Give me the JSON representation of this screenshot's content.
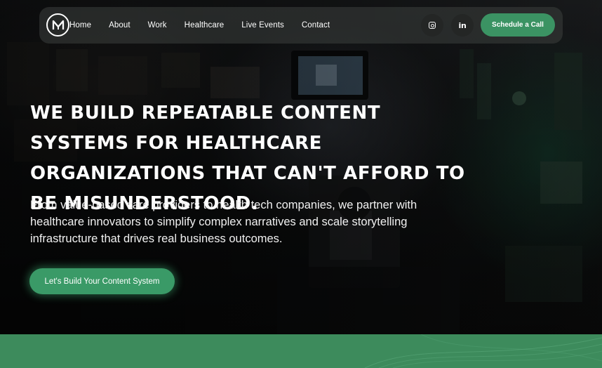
{
  "brand": {
    "logo_icon": "m-monogram-logo-icon"
  },
  "nav": {
    "items": [
      {
        "label": "Home"
      },
      {
        "label": "About"
      },
      {
        "label": "Work"
      },
      {
        "label": "Healthcare"
      },
      {
        "label": "Live Events"
      },
      {
        "label": "Contact"
      }
    ],
    "social": [
      {
        "icon": "instagram-icon"
      },
      {
        "icon": "linkedin-icon",
        "glyph": "in"
      }
    ],
    "cta_label": "Schedule a Call"
  },
  "hero": {
    "headline": "WE BUILD REPEATABLE CONTENT SYSTEMS FOR HEALTHCARE ORGANIZATIONS THAT CAN'T AFFORD TO BE MISUNDERSTOOD.",
    "subtext": "From value-based care providers to health tech companies, we partner with healthcare innovators to simplify complex narratives and scale storytelling infrastructure that drives real business outcomes.",
    "cta_label": "Let's Build Your Content System"
  },
  "colors": {
    "accent_green": "#3b9363",
    "band_green": "#3d8b5c",
    "text": "#ffffff"
  }
}
